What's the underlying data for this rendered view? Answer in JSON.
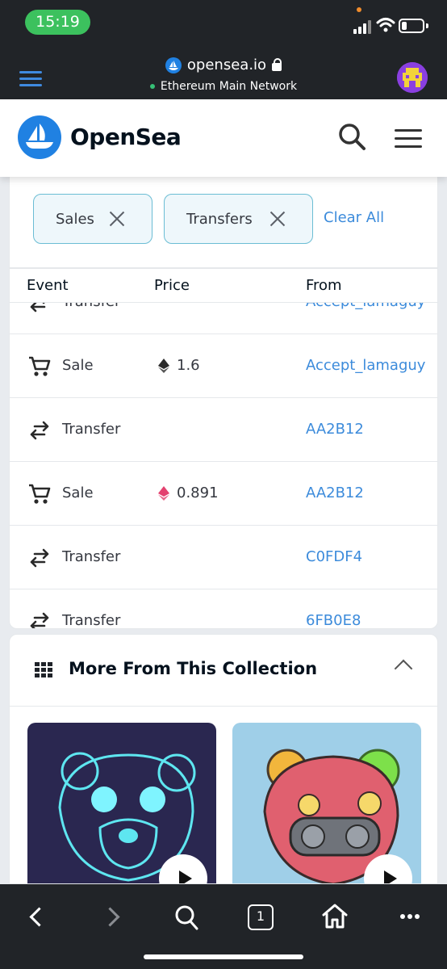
{
  "status_bar": {
    "time": "15:19"
  },
  "browser": {
    "url": "opensea.io",
    "network": "Ethereum Main Network"
  },
  "site": {
    "brand": "OpenSea"
  },
  "filters": {
    "chips": [
      "Sales",
      "Transfers"
    ],
    "clear_all": "Clear All"
  },
  "activity_table": {
    "headers": {
      "event": "Event",
      "price": "Price",
      "from": "From"
    },
    "rows": [
      {
        "event": "Transfer",
        "price": "",
        "from": "Accept_lamaguy",
        "event_icon": "transfer-icon"
      },
      {
        "event": "Sale",
        "price": "1.6",
        "from": "Accept_lamaguy",
        "event_icon": "cart-icon",
        "currency": "eth-black",
        "currency_color": "#2b2b2b"
      },
      {
        "event": "Transfer",
        "price": "",
        "from": "AA2B12",
        "event_icon": "transfer-icon"
      },
      {
        "event": "Sale",
        "price": "0.891",
        "from": "AA2B12",
        "event_icon": "cart-icon",
        "currency": "weth-pink",
        "currency_color": "#e3416f"
      },
      {
        "event": "Transfer",
        "price": "",
        "from": "C0FDF4",
        "event_icon": "transfer-icon"
      },
      {
        "event": "Transfer",
        "price": "",
        "from": "6FB0E8",
        "event_icon": "transfer-icon"
      }
    ]
  },
  "collection": {
    "title": "More From This Collection"
  },
  "bottom_nav": {
    "tab_count": "1"
  },
  "colors": {
    "accent": "#2081e2",
    "link": "#3c8bdb",
    "status_green": "#3cc15e",
    "chrome": "#212428"
  }
}
